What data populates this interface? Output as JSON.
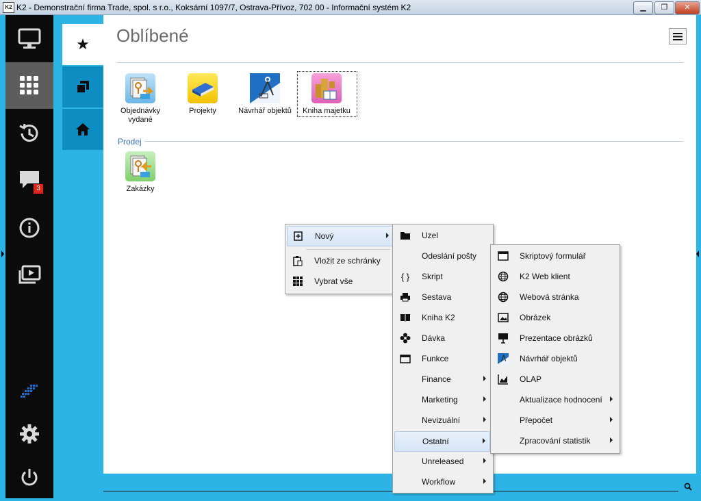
{
  "window": {
    "app_badge": "K2",
    "title": "K2 - Demonstrační firma Trade, spol. s r.o., Koksární 1097/7, Ostrava-Přívoz, 702 00 - Informační systém K2",
    "minimize": "▁",
    "maximize": "❐",
    "close": "✕"
  },
  "sidebar": {
    "items": [
      {
        "name": "desktop-icon"
      },
      {
        "name": "apps-grid-icon",
        "active": true
      },
      {
        "name": "history-icon"
      },
      {
        "name": "messages-icon",
        "badge": "3"
      },
      {
        "name": "info-icon"
      },
      {
        "name": "media-icon"
      }
    ],
    "bottom": [
      {
        "name": "k2-logo-icon"
      },
      {
        "name": "settings-gear-icon"
      },
      {
        "name": "power-icon"
      }
    ]
  },
  "tabs": [
    {
      "name": "favorites-star",
      "glyph": "★",
      "active": true
    },
    {
      "name": "windows",
      "glyph": ""
    },
    {
      "name": "home",
      "glyph": ""
    }
  ],
  "main": {
    "title": "Oblíbené",
    "favorites": [
      {
        "line1": "Objednávky",
        "line2": "vydané"
      },
      {
        "line1": "Projekty",
        "line2": ""
      },
      {
        "line1": "Návrhář objektů",
        "line2": ""
      },
      {
        "line1": "Kniha majetku",
        "line2": ""
      }
    ],
    "section": "Prodej",
    "section_items": [
      {
        "line1": "Zakázky",
        "line2": ""
      }
    ]
  },
  "context_menu": {
    "items": [
      {
        "label": "Nový",
        "icon": "new-item-icon",
        "submenu": true
      },
      {
        "label": "Vložit ze schránky",
        "icon": "paste-icon"
      },
      {
        "label": "Vybrat vše",
        "icon": "select-all-icon"
      }
    ]
  },
  "submenu_novy": {
    "items": [
      {
        "label": "Uzel",
        "icon": "folder-icon"
      },
      {
        "label": "Odeslání pošty",
        "icon": ""
      },
      {
        "label": "Skript",
        "icon": "braces-icon",
        "glyph": "{ }"
      },
      {
        "label": "Sestava",
        "icon": "printer-icon"
      },
      {
        "label": "Kniha K2",
        "icon": "book-icon"
      },
      {
        "label": "Dávka",
        "icon": "flower-icon"
      },
      {
        "label": "Funkce",
        "icon": "function-window-icon"
      },
      {
        "label": "Finance",
        "icon": "",
        "submenu": true
      },
      {
        "label": "Marketing",
        "icon": "",
        "submenu": true
      },
      {
        "label": "Nevizuální",
        "icon": "",
        "submenu": true
      },
      {
        "label": "Ostatní",
        "icon": "",
        "submenu": true,
        "highlighted": true
      },
      {
        "label": "Unreleased",
        "icon": "",
        "submenu": true
      },
      {
        "label": "Workflow",
        "icon": "",
        "submenu": true
      }
    ]
  },
  "submenu_ostatni": {
    "items": [
      {
        "label": "Skriptový formulář",
        "icon": "form-window-icon"
      },
      {
        "label": "K2 Web klient",
        "icon": "globe-icon"
      },
      {
        "label": "Webová stránka",
        "icon": "globe-icon"
      },
      {
        "label": "Obrázek",
        "icon": "picture-icon"
      },
      {
        "label": "Prezentace obrázků",
        "icon": "presentation-icon"
      },
      {
        "label": "Návrhář objektů",
        "icon": "designer-icon"
      },
      {
        "label": "OLAP",
        "icon": "olap-chart-icon"
      },
      {
        "label": "Aktualizace hodnocení",
        "icon": "",
        "submenu": true
      },
      {
        "label": "Přepočet",
        "icon": "",
        "submenu": true
      },
      {
        "label": "Zpracování statistik",
        "icon": "",
        "submenu": true
      }
    ]
  },
  "colors": {
    "accent": "#2cb4e6",
    "tab_dark": "#0d8dc2",
    "sidebar": "#0b0b0b",
    "badge": "#e2231a",
    "section": "#3a6fb0"
  }
}
